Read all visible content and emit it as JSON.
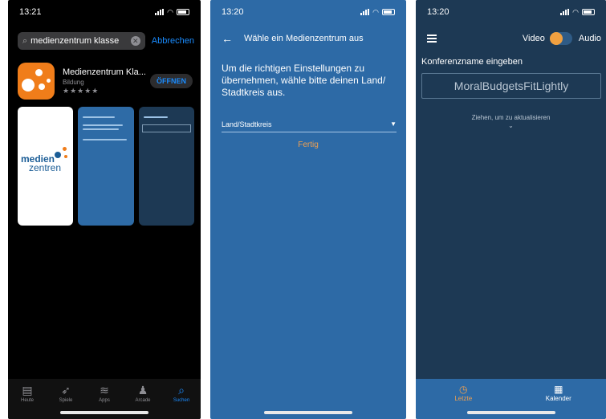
{
  "phone1": {
    "time": "13:21",
    "search_text": "medienzentrum klasse",
    "cancel_label": "Abbrechen",
    "app_name": "Medienzentrum Kla...",
    "app_category": "Bildung",
    "rating_stars": "★★★★★",
    "open_label": "ÖFFNEN",
    "logo_lines": [
      "medien",
      "zentren"
    ],
    "tabs": [
      {
        "label": "Heute",
        "icon": "today-icon"
      },
      {
        "label": "Spiele",
        "icon": "rocket-icon"
      },
      {
        "label": "Apps",
        "icon": "layers-icon"
      },
      {
        "label": "Arcade",
        "icon": "joystick-icon"
      },
      {
        "label": "Suchen",
        "icon": "search-icon",
        "active": true
      }
    ]
  },
  "phone2": {
    "time": "13:20",
    "title": "Wähle ein Medienzentrum aus",
    "intro": "Um die richtigen Einstellungen zu übernehmen, wähle bitte deinen Land/ Stadtkreis aus.",
    "select_label": "Land/Stadtkreis",
    "done_label": "Fertig"
  },
  "phone3": {
    "time": "13:20",
    "video_label": "Video",
    "audio_label": "Audio",
    "conference_label": "Konferenzname eingeben",
    "conference_name": "MoralBudgetsFitLightly",
    "pull_hint": "Ziehen, um zu aktualisieren",
    "tabs": [
      {
        "label": "Letzte",
        "icon": "history-icon",
        "active": true
      },
      {
        "label": "Kalender",
        "icon": "calendar-icon"
      }
    ]
  },
  "colors": {
    "appstore_bg": "#000000",
    "blue_screen": "#2d6aa6",
    "dark_screen": "#1d3954",
    "accent_orange": "#f0a050",
    "ios_blue": "#1a8cff"
  }
}
